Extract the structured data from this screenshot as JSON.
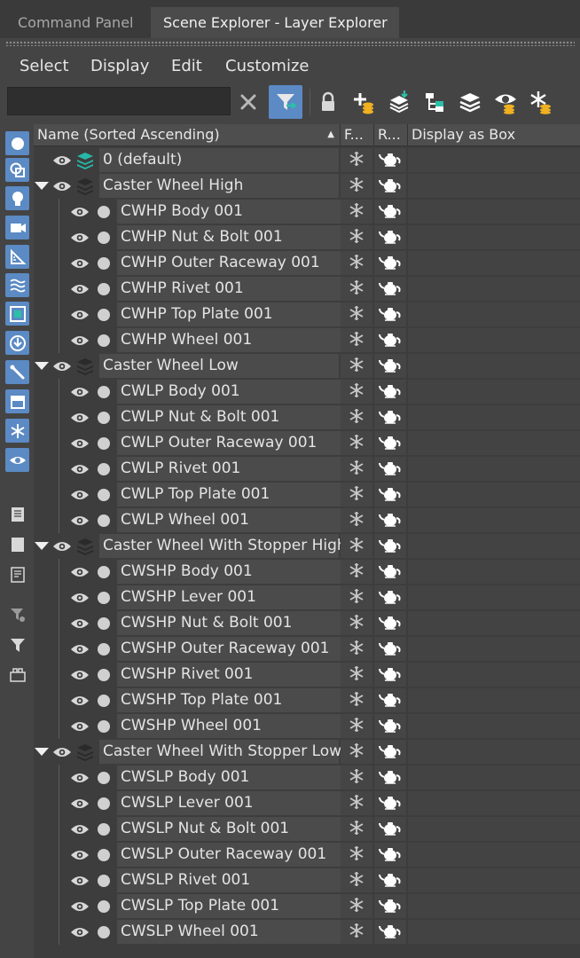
{
  "tabs": [
    {
      "label": "Command Panel",
      "active": false
    },
    {
      "label": "Scene Explorer - Layer Explorer",
      "active": true
    }
  ],
  "menu": [
    "Select",
    "Display",
    "Edit",
    "Customize"
  ],
  "search": {
    "value": "",
    "placeholder": ""
  },
  "toolbar_icons": [
    "clear-x-icon",
    "filter-select-icon",
    "lock-icon",
    "add-layer-icon",
    "merge-layers-icon",
    "hierarchy-icon",
    "layers-icon",
    "hide-layers-icon",
    "freeze-layers-icon"
  ],
  "left_toolbar_icons": [
    "geometry-icon",
    "shape-icon",
    "light-icon",
    "camera-icon",
    "helper-icon",
    "spacewarp-icon",
    "group-icon",
    "xref-icon",
    "bone-icon",
    "container-icon",
    "frozen-icon",
    "hidden-icon",
    "list-icon",
    "square-icon",
    "text-list-icon",
    "filter-settings-icon",
    "filter-icon",
    "layer-stack-icon"
  ],
  "columns": {
    "name": "Name (Sorted Ascending)",
    "frozen": "F...",
    "render": "R...",
    "box": "Display as Box"
  },
  "colors": {
    "accent": "#5b8ac4",
    "background": "#444444",
    "layer_icon_teal": "#27b8a6"
  },
  "rows": [
    {
      "type": "layer",
      "label": "0 (default)",
      "expanded": false,
      "current": true
    },
    {
      "type": "layer",
      "label": "Caster Wheel High",
      "expanded": true,
      "current": false
    },
    {
      "type": "object",
      "label": "CWHP Body 001"
    },
    {
      "type": "object",
      "label": "CWHP Nut & Bolt 001"
    },
    {
      "type": "object",
      "label": "CWHP Outer Raceway 001"
    },
    {
      "type": "object",
      "label": "CWHP Rivet 001"
    },
    {
      "type": "object",
      "label": "CWHP Top Plate 001"
    },
    {
      "type": "object",
      "label": "CWHP Wheel 001"
    },
    {
      "type": "layer",
      "label": "Caster Wheel Low",
      "expanded": true,
      "current": false
    },
    {
      "type": "object",
      "label": "CWLP Body 001"
    },
    {
      "type": "object",
      "label": "CWLP Nut & Bolt 001"
    },
    {
      "type": "object",
      "label": "CWLP Outer Raceway 001"
    },
    {
      "type": "object",
      "label": "CWLP Rivet 001"
    },
    {
      "type": "object",
      "label": "CWLP Top Plate 001"
    },
    {
      "type": "object",
      "label": "CWLP Wheel 001"
    },
    {
      "type": "layer",
      "label": "Caster Wheel With Stopper High",
      "expanded": true,
      "current": false
    },
    {
      "type": "object",
      "label": "CWSHP Body 001"
    },
    {
      "type": "object",
      "label": "CWSHP Lever 001"
    },
    {
      "type": "object",
      "label": "CWSHP Nut & Bolt 001"
    },
    {
      "type": "object",
      "label": "CWSHP Outer Raceway 001"
    },
    {
      "type": "object",
      "label": "CWSHP Rivet 001"
    },
    {
      "type": "object",
      "label": "CWSHP Top Plate 001"
    },
    {
      "type": "object",
      "label": "CWSHP Wheel 001"
    },
    {
      "type": "layer",
      "label": "Caster Wheel With Stopper Low",
      "expanded": true,
      "current": false
    },
    {
      "type": "object",
      "label": "CWSLP Body 001"
    },
    {
      "type": "object",
      "label": "CWSLP Lever 001"
    },
    {
      "type": "object",
      "label": "CWSLP Nut & Bolt 001"
    },
    {
      "type": "object",
      "label": "CWSLP Outer Raceway 001"
    },
    {
      "type": "object",
      "label": "CWSLP Rivet 001"
    },
    {
      "type": "object",
      "label": "CWSLP Top Plate 001"
    },
    {
      "type": "object",
      "label": "CWSLP Wheel 001"
    }
  ]
}
